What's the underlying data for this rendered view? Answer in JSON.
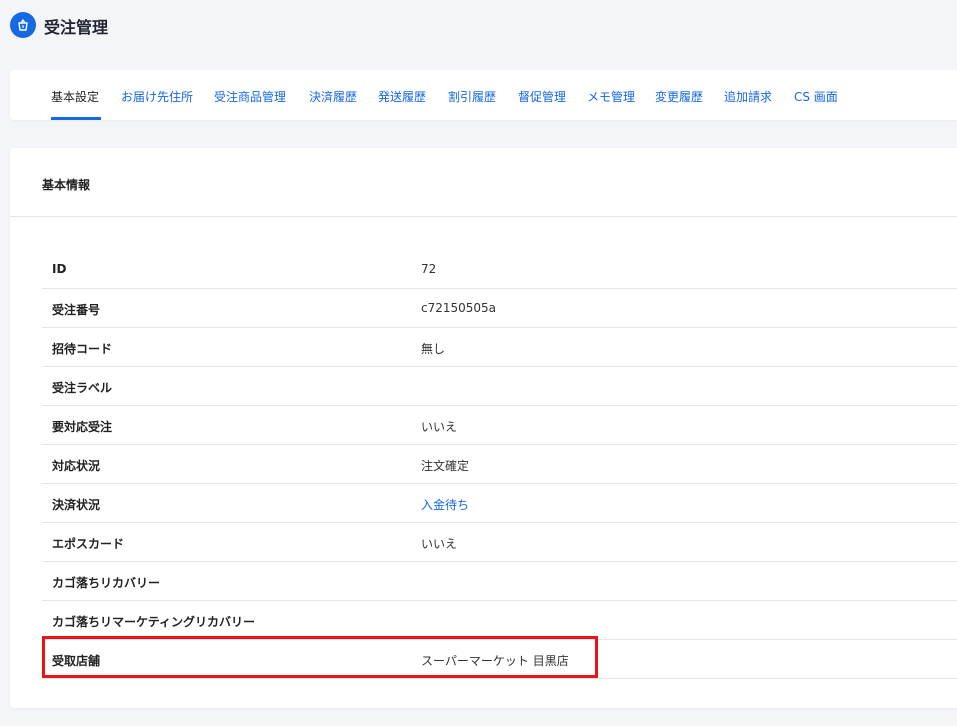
{
  "header": {
    "title": "受注管理",
    "icon": "order-basket-icon"
  },
  "tabs": [
    {
      "label": "基本設定",
      "active": true
    },
    {
      "label": "お届け先住所"
    },
    {
      "label": "受注商品管理"
    },
    {
      "label": "決済履歴"
    },
    {
      "label": "発送履歴"
    },
    {
      "label": "割引履歴"
    },
    {
      "label": "督促管理"
    },
    {
      "label": "メモ管理"
    },
    {
      "label": "変更履歴"
    },
    {
      "label": "追加請求"
    },
    {
      "label": "CS 画面"
    }
  ],
  "info": {
    "title": "基本情報",
    "rows": [
      {
        "label": "ID",
        "value": "72"
      },
      {
        "label": "受注番号",
        "value": "c72150505a"
      },
      {
        "label": "招待コード",
        "value": "無し"
      },
      {
        "label": "受注ラベル",
        "value": ""
      },
      {
        "label": "要対応受注",
        "value": "いいえ"
      },
      {
        "label": "対応状況",
        "value": "注文確定"
      },
      {
        "label": "決済状況",
        "value": "入金待ち"
      },
      {
        "label": "エポスカード",
        "value": "いいえ"
      },
      {
        "label": "カゴ落ちリカバリー",
        "value": ""
      },
      {
        "label": "カゴ落ちリマーケティングリカバリー",
        "value": ""
      },
      {
        "label": "受取店舗",
        "value": "スーパーマーケット 目黒店"
      }
    ]
  },
  "colors": {
    "accent": "#1668e3",
    "highlight": "#e8141a"
  }
}
